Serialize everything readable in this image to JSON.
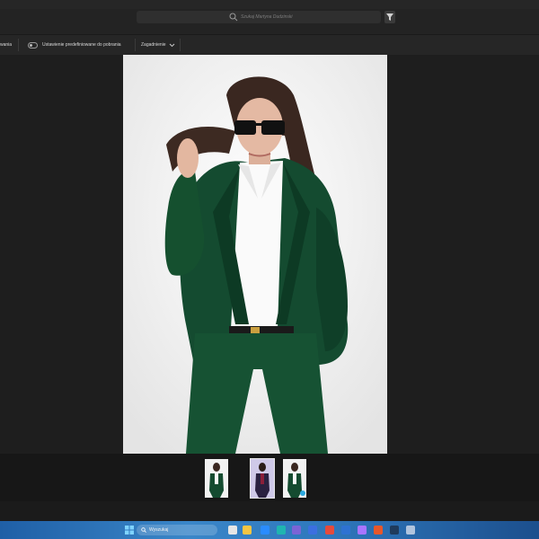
{
  "search": {
    "placeholder": "Szukaj Martyna Dudzinski"
  },
  "toolbar": {
    "left_truncated": "wania",
    "preset_label": "Ustawienie predefiniowane do pobrania",
    "issues_label": "Zagadnienie"
  },
  "taskbar": {
    "search_label": "Wyszukaj"
  }
}
